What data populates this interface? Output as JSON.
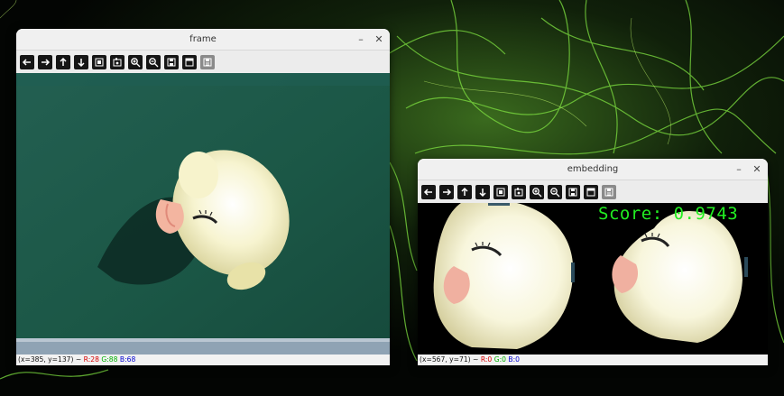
{
  "frame_window": {
    "title": "frame",
    "status": {
      "coords": "(x=385, y=137) ~",
      "r": "R:28",
      "g": "G:88",
      "b": "B:68"
    }
  },
  "embedding_window": {
    "title": "embedding",
    "score_text": "Score: 0.9743",
    "status": {
      "coords": "(x=567, y=71) ~",
      "r": "R:0",
      "g": "G:0",
      "b": "B:0"
    }
  },
  "window_controls": {
    "minimize": "–",
    "close": "✕"
  },
  "toolbar_icons": [
    "pan-left-icon",
    "pan-right-icon",
    "pan-up-icon",
    "pan-down-icon",
    "zoom-fit-icon",
    "zoom-region-icon",
    "zoom-in-icon",
    "zoom-out-icon",
    "save-icon",
    "properties-icon",
    "expanded-panel-icon"
  ],
  "colors": {
    "score_text": "#22ee22",
    "frame_background": "#1c5a48",
    "embedding_background": "#000000",
    "duck": "#f4f0c0"
  }
}
